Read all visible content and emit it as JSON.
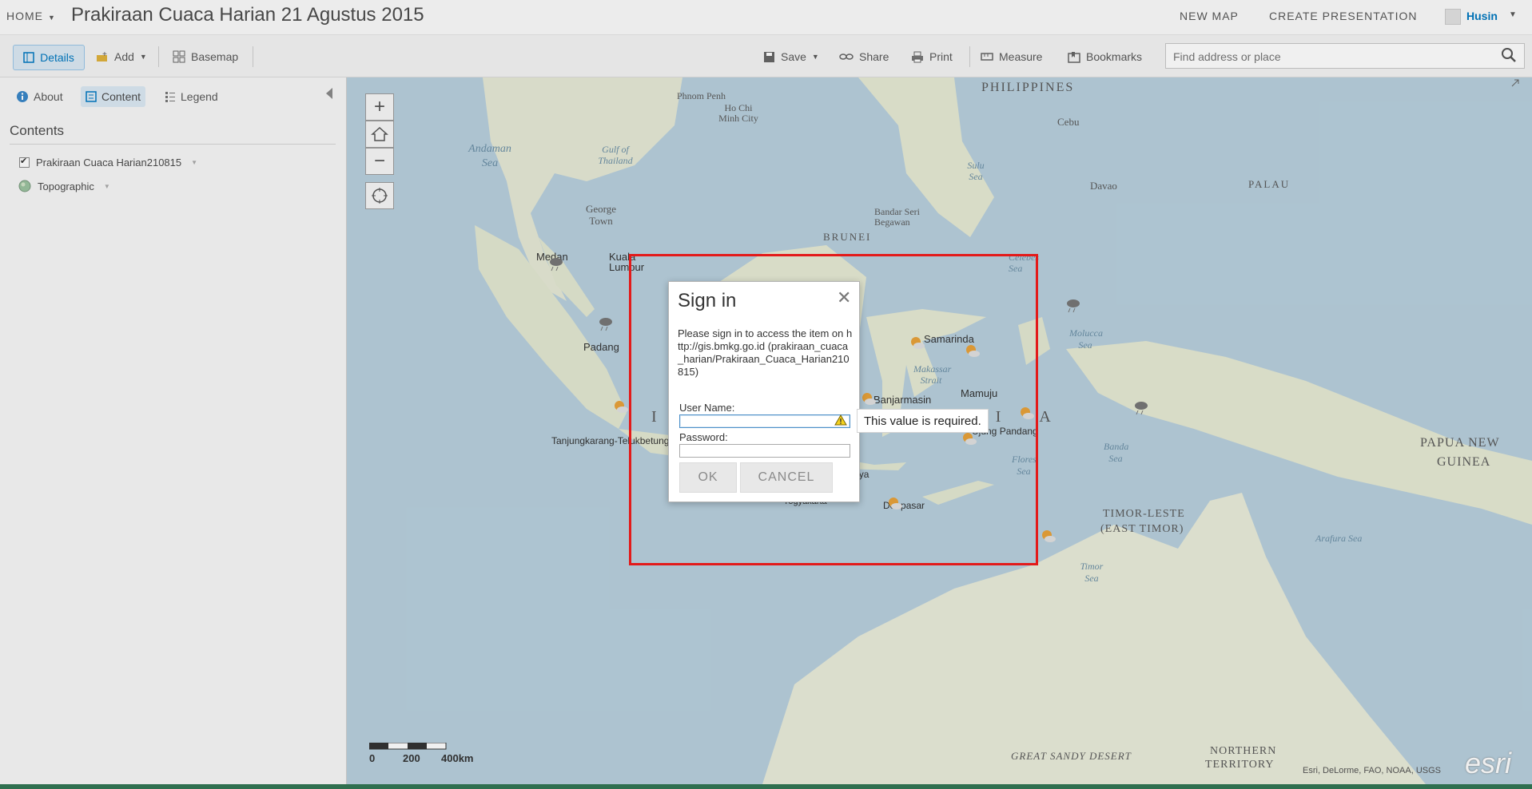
{
  "header": {
    "home_label": "HOME",
    "map_title": "Prakiraan Cuaca Harian 21 Agustus 2015",
    "new_map": "NEW MAP",
    "create_presentation": "CREATE PRESENTATION",
    "user_name": "Husin"
  },
  "toolbar": {
    "details": "Details",
    "add": "Add",
    "basemap": "Basemap",
    "save": "Save",
    "share": "Share",
    "print": "Print",
    "measure": "Measure",
    "bookmarks": "Bookmarks",
    "search_placeholder": "Find address or place"
  },
  "sidebar": {
    "tabs": [
      {
        "label": "About"
      },
      {
        "label": "Content"
      },
      {
        "label": "Legend"
      }
    ],
    "heading": "Contents",
    "layers": [
      {
        "label": "Prakiraan Cuaca Harian210815",
        "checked": true
      },
      {
        "label": "Topographic"
      }
    ]
  },
  "dialog": {
    "title": "Sign in",
    "message": "Please sign in to access the item on http://gis.bmkg.go.id (prakiraan_cuaca_harian/Prakiraan_Cuaca_Harian210815)",
    "username_label": "User Name:",
    "password_label": "Password:",
    "tooltip": "This value is required.",
    "ok": "OK",
    "cancel": "CANCEL"
  },
  "map": {
    "labels": {
      "philippines": "PHILIPPINES",
      "phnom_penh": "Phnom Penh",
      "ho_chi_minh": "Ho Chi Minh City",
      "andaman_sea": "Andaman Sea",
      "gulf_thailand": "Gulf of Thailand",
      "sulu_sea": "Sulu Sea",
      "cebu": "Cebu",
      "davao": "Davao",
      "palau": "PALAU",
      "george_town": "George Town",
      "bandar": "Bandar Seri Begawan",
      "brunei": "BRUNEI",
      "medan": "Medan",
      "kuala_lumpur": "Kuala Lumpur",
      "celebes_sea": "Celebes Sea",
      "padang": "Padang",
      "samarinda": "Samarinda",
      "molucca_sea": "Molucca Sea",
      "makassar_strait": "Makassar Strait",
      "banjarmasin": "Banjarmasin",
      "mamuju": "Mamuju",
      "tanjungkarang": "Tanjungkarang-Telukbetung",
      "ujung_pandang": "Ujung Pandang",
      "banda_sea": "Banda Sea",
      "flores_sea": "Flores Sea",
      "surabaya": "Surabaya",
      "denpasar": "Denpasar",
      "yogyakarta": "Yogyakarta",
      "timor_leste": "TIMOR-LESTE",
      "east_timor": "(EAST TIMOR)",
      "papua": "PAPUA NEW",
      "guinea": "GUINEA",
      "arafura": "Arafura Sea",
      "timor_sea": "Timor Sea",
      "great_sandy": "GREAT SANDY DESERT",
      "northern": "NORTHERN",
      "territory": "TERRITORY",
      "indonesia": "I N D O N E S I A"
    },
    "scale": {
      "zero": "0",
      "mid": "200",
      "max": "400km"
    },
    "attribution": "Esri, DeLorme, FAO, NOAA, USGS",
    "logo": "esri"
  },
  "colors": {
    "accent": "#0079c1",
    "highlight_box": "#e31a1a",
    "sea": "#b8d0de",
    "land": "#e8ead8"
  }
}
